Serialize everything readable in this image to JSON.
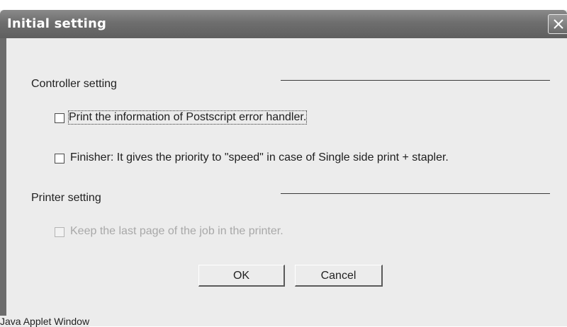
{
  "window": {
    "title": "Initial setting",
    "close_icon": "close-icon"
  },
  "controller_section": {
    "label": "Controller setting",
    "options": [
      {
        "label": "Print the information of Postscript error handler.",
        "checked": false,
        "enabled": true,
        "focused": true
      },
      {
        "label": "Finisher: It gives the priority to \"speed\" in case of Single side print + stapler.",
        "checked": false,
        "enabled": true,
        "focused": false
      }
    ]
  },
  "printer_section": {
    "label": "Printer setting",
    "options": [
      {
        "label": "Keep the last page of the job in the printer.",
        "checked": false,
        "enabled": false,
        "focused": false
      }
    ]
  },
  "buttons": {
    "ok_label": "OK",
    "cancel_label": "Cancel"
  },
  "status": {
    "text": "Java Applet Window"
  },
  "colors": {
    "titlebar": "#6e6e6e",
    "background": "#ececec",
    "disabled_text": "#a8a8a8"
  }
}
